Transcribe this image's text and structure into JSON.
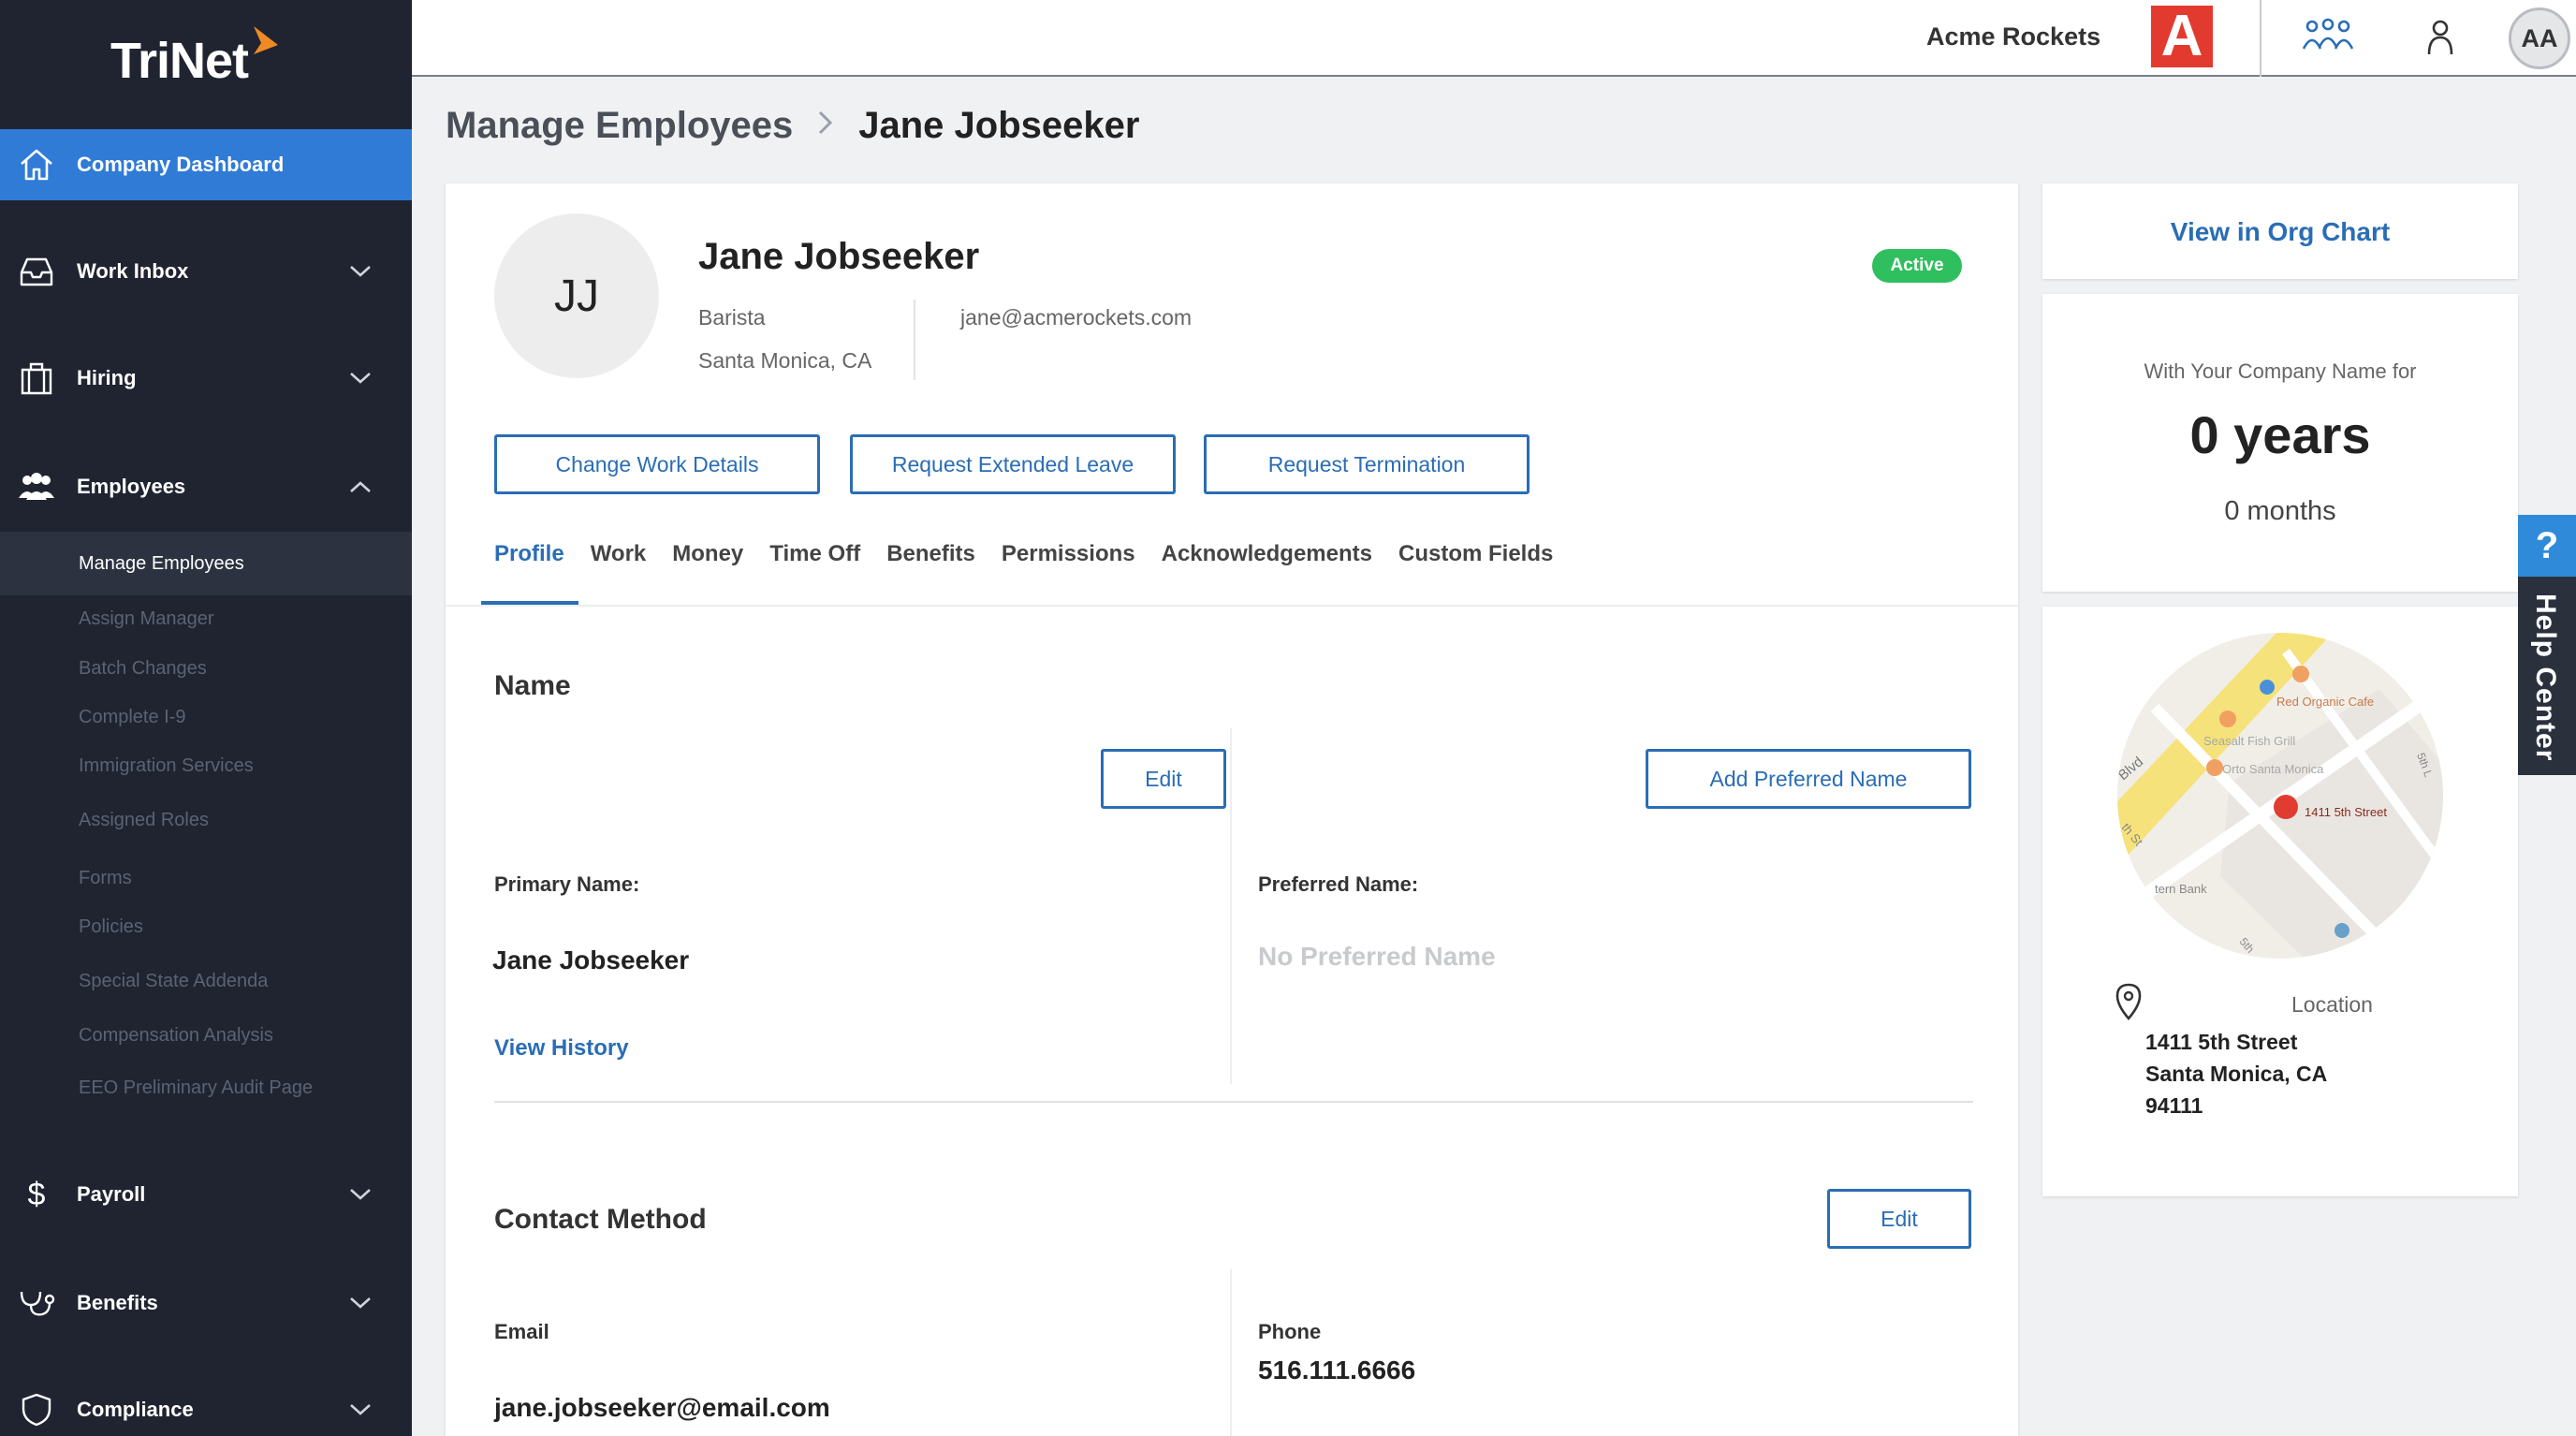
{
  "brand": {
    "name": "TriNet",
    "accent": "#f08a24"
  },
  "sidebar": {
    "items": [
      {
        "label": "Company Dashboard",
        "icon": "home-icon",
        "active": true
      },
      {
        "label": "Work Inbox",
        "icon": "inbox-icon"
      },
      {
        "label": "Hiring",
        "icon": "briefcase-icon"
      },
      {
        "label": "Employees",
        "icon": "people-icon",
        "expanded": true
      },
      {
        "label": "Payroll",
        "icon": "dollar-icon"
      },
      {
        "label": "Benefits",
        "icon": "stethoscope-icon"
      },
      {
        "label": "Compliance",
        "icon": "shield-icon"
      }
    ],
    "employees_sub": [
      "Manage Employees",
      "Assign Manager",
      "Batch Changes",
      "Complete I-9",
      "Immigration Services",
      "Assigned Roles",
      "Forms",
      "Policies",
      "Special State Addenda",
      "Compensation Analysis",
      "EEO Preliminary Audit Page"
    ]
  },
  "topbar": {
    "company": "Acme Rockets",
    "company_logo_letter": "A",
    "user_initials": "AA"
  },
  "breadcrumb": {
    "parent": "Manage Employees",
    "current": "Jane Jobseeker"
  },
  "employee": {
    "initials": "JJ",
    "name": "Jane Jobseeker",
    "title": "Barista",
    "location": "Santa Monica, CA",
    "email": "jane@acmerockets.com",
    "status": "Active"
  },
  "actions": {
    "change_work": "Change Work Details",
    "extended_leave": "Request Extended Leave",
    "termination": "Request Termination"
  },
  "tabs": [
    "Profile",
    "Work",
    "Money",
    "Time Off",
    "Benefits",
    "Permissions",
    "Acknowledgements",
    "Custom Fields"
  ],
  "name_section": {
    "title": "Name",
    "edit": "Edit",
    "add_preferred": "Add Preferred Name",
    "primary_label": "Primary Name:",
    "primary_value": "Jane Jobseeker",
    "view_history": "View History",
    "preferred_label": "Preferred Name:",
    "preferred_value": "No Preferred Name"
  },
  "contact_section": {
    "title": "Contact Method",
    "edit": "Edit",
    "email_label": "Email",
    "email_value": "jane.jobseeker@email.com",
    "phone_label": "Phone",
    "phone_value": "516.111.6666"
  },
  "right": {
    "org_chart": "View in Org Chart",
    "tenure_label": "With Your Company Name for",
    "tenure_years": "0 years",
    "tenure_months": "0 months",
    "location_label": "Location",
    "address_line1": "1411 5th Street",
    "address_line2": "Santa Monica, CA",
    "address_line3": "94111",
    "map_labels": {
      "red_organic": "Red Organic Cafe",
      "seasalt": "Seasalt Fish Grill",
      "orto": "Orto Santa Monica",
      "fifth": "1411 5th Street",
      "blvd": "Blvd",
      "bank": "tern Bank",
      "st": "th St",
      "sth": "5th",
      "sthl": "5th L"
    }
  },
  "help": {
    "q": "?",
    "label": "Help Center"
  }
}
